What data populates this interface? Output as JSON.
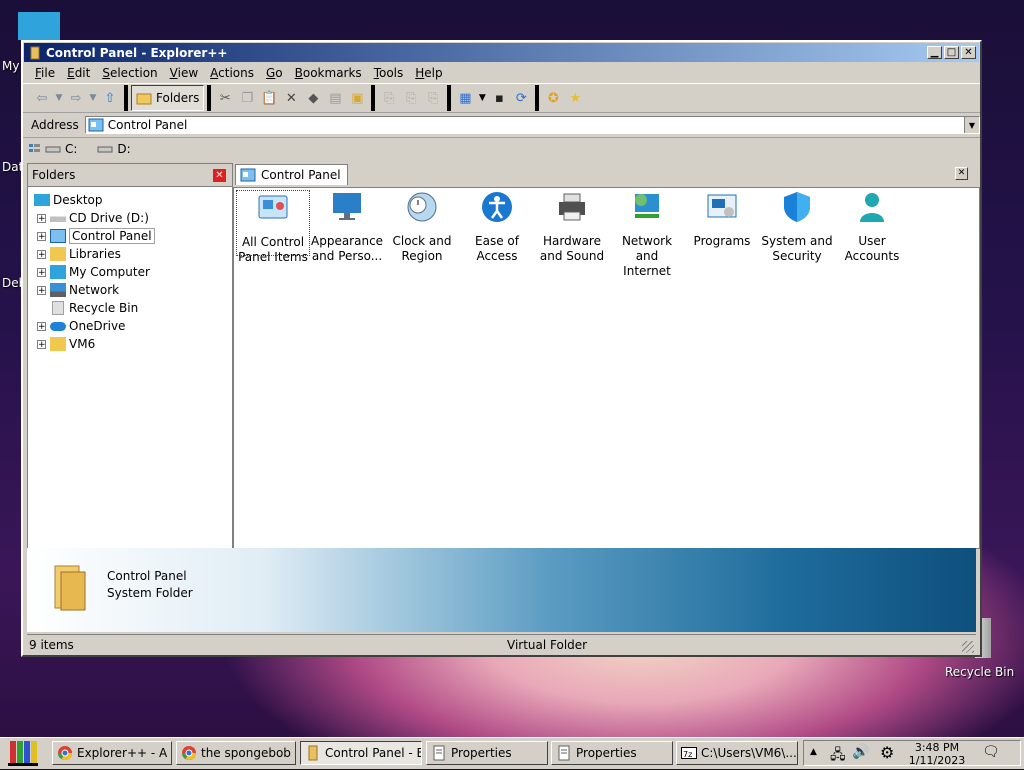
{
  "desktop": {
    "left_labels": [
      "My",
      "Dat",
      "Deb"
    ],
    "recycle_bin": "Recycle Bin"
  },
  "window": {
    "title": "Control Panel - Explorer++",
    "menu": [
      "File",
      "Edit",
      "Selection",
      "View",
      "Actions",
      "Go",
      "Bookmarks",
      "Tools",
      "Help"
    ],
    "folders_button": "Folders",
    "address_label": "Address",
    "address_value": "Control Panel",
    "drives": [
      "C:",
      "D:"
    ],
    "folders_pane_title": "Folders",
    "tree": [
      {
        "label": "Desktop",
        "expander": false,
        "level": 0
      },
      {
        "label": "CD Drive (D:)",
        "expander": true,
        "level": 1
      },
      {
        "label": "Control Panel",
        "expander": true,
        "level": 1,
        "selected": true
      },
      {
        "label": "Libraries",
        "expander": true,
        "level": 1
      },
      {
        "label": "My Computer",
        "expander": true,
        "level": 1
      },
      {
        "label": "Network",
        "expander": true,
        "level": 1
      },
      {
        "label": "Recycle Bin",
        "expander": false,
        "level": 1
      },
      {
        "label": "OneDrive",
        "expander": true,
        "level": 1
      },
      {
        "label": "VM6",
        "expander": true,
        "level": 1
      }
    ],
    "tab_label": "Control Panel",
    "items": [
      {
        "line1": "All Control",
        "line2": "Panel Items",
        "icon": "all-items-icon",
        "color": "#3a8fd8"
      },
      {
        "line1": "Appearance",
        "line2": "and Perso...",
        "icon": "appearance-icon",
        "color": "#2a7fc8"
      },
      {
        "line1": "Clock and",
        "line2": "Region",
        "icon": "clock-globe-icon",
        "color": "#4a90c0"
      },
      {
        "line1": "Ease of",
        "line2": "Access",
        "icon": "accessibility-icon",
        "color": "#1a78d0"
      },
      {
        "line1": "Hardware",
        "line2": "and Sound",
        "icon": "printer-icon",
        "color": "#606060"
      },
      {
        "line1": "Network and",
        "line2": "Internet",
        "icon": "network-icon",
        "color": "#2a90d0"
      },
      {
        "line1": "Programs",
        "line2": "",
        "icon": "programs-icon",
        "color": "#2070b8"
      },
      {
        "line1": "System and",
        "line2": "Security",
        "icon": "shield-icon",
        "color": "#1a80d8"
      },
      {
        "line1": "User",
        "line2": "Accounts",
        "icon": "user-icon",
        "color": "#20a8b0"
      }
    ],
    "details_line1": "Control Panel",
    "details_line2": "System Folder",
    "status_left": "9 items",
    "status_center": "Virtual Folder"
  },
  "taskbar": {
    "tasks": [
      {
        "label": "Explorer++ - A s...",
        "icon": "chrome-icon"
      },
      {
        "label": "the spongebob s...",
        "icon": "chrome-icon"
      },
      {
        "label": "Control Panel - E...",
        "icon": "folder-icon",
        "active": true
      },
      {
        "label": "Properties",
        "icon": "properties-icon"
      },
      {
        "label": "Properties",
        "icon": "properties-icon"
      },
      {
        "label": "C:\\Users\\VM6\\...",
        "icon": "7zip-icon"
      }
    ],
    "time": "3:48 PM",
    "date": "1/11/2023"
  }
}
